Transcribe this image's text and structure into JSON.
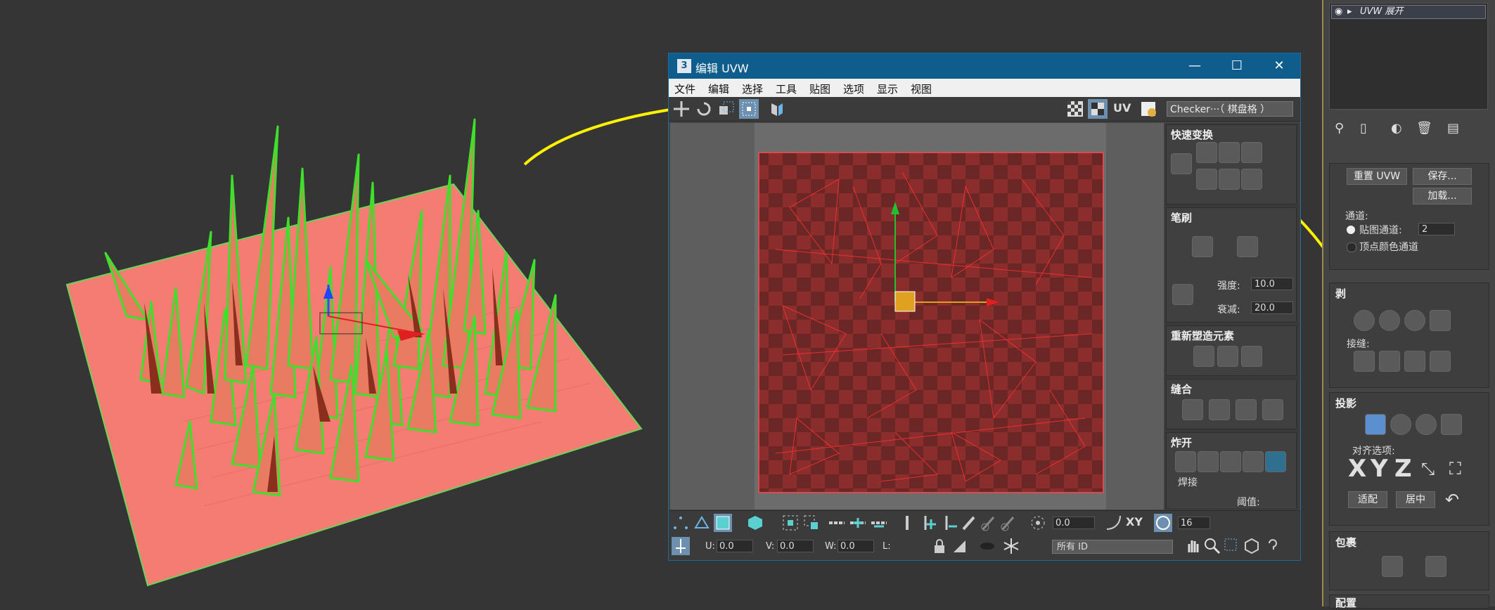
{
  "window": {
    "title": "编辑 UVW",
    "app_icon": "3",
    "minimize": "—",
    "maximize": "☐",
    "close": "✕"
  },
  "menu": [
    "文件",
    "编辑",
    "选择",
    "工具",
    "贴图",
    "选项",
    "显示",
    "视图"
  ],
  "toolbar": {
    "uv_label": "UV",
    "checker_select": "Checker···（ 棋盘格 ）"
  },
  "panel": {
    "quick_transform": "快速变换",
    "brush": "笔刷",
    "strength_label": "强度:",
    "strength_value": "10.0",
    "falloff_label": "衰减:",
    "falloff_value": "20.0",
    "reshape": "重新塑造元素",
    "stitch": "缝合",
    "explode": "炸开",
    "weld": "焊接",
    "threshold_label": "阈值:"
  },
  "bottom": {
    "angle_value": "0.0",
    "xy_label": "XY",
    "spin_value": "16",
    "u_label": "U:",
    "u_value": "0.0",
    "v_label": "V:",
    "v_value": "0.0",
    "w_label": "W:",
    "w_value": "0.0",
    "l_label": "L:",
    "id_select": "所有 ID"
  },
  "cmd": {
    "modifier": "UVW 展开",
    "reset_uvw": "重置 UVW",
    "save": "保存...",
    "load": "加载...",
    "channel_label": "通道:",
    "map_channel": "贴图通道:",
    "map_channel_value": "2",
    "vertex_color_channel": "顶点颜色通道",
    "peel": "剥",
    "seams": "接缝:",
    "projection": "投影",
    "align_options": "对齐选项:",
    "axis_x": "X",
    "axis_y": "Y",
    "axis_z": "Z",
    "fit": "适配",
    "center": "居中",
    "wrap": "包裹",
    "config": "配置"
  },
  "colors": {
    "plane": "#f47c73",
    "grass_edge": "#3ee02b",
    "uv_red": "#8c2d2d",
    "annotation": "#fff200",
    "title_bar": "#0e5d8c"
  }
}
